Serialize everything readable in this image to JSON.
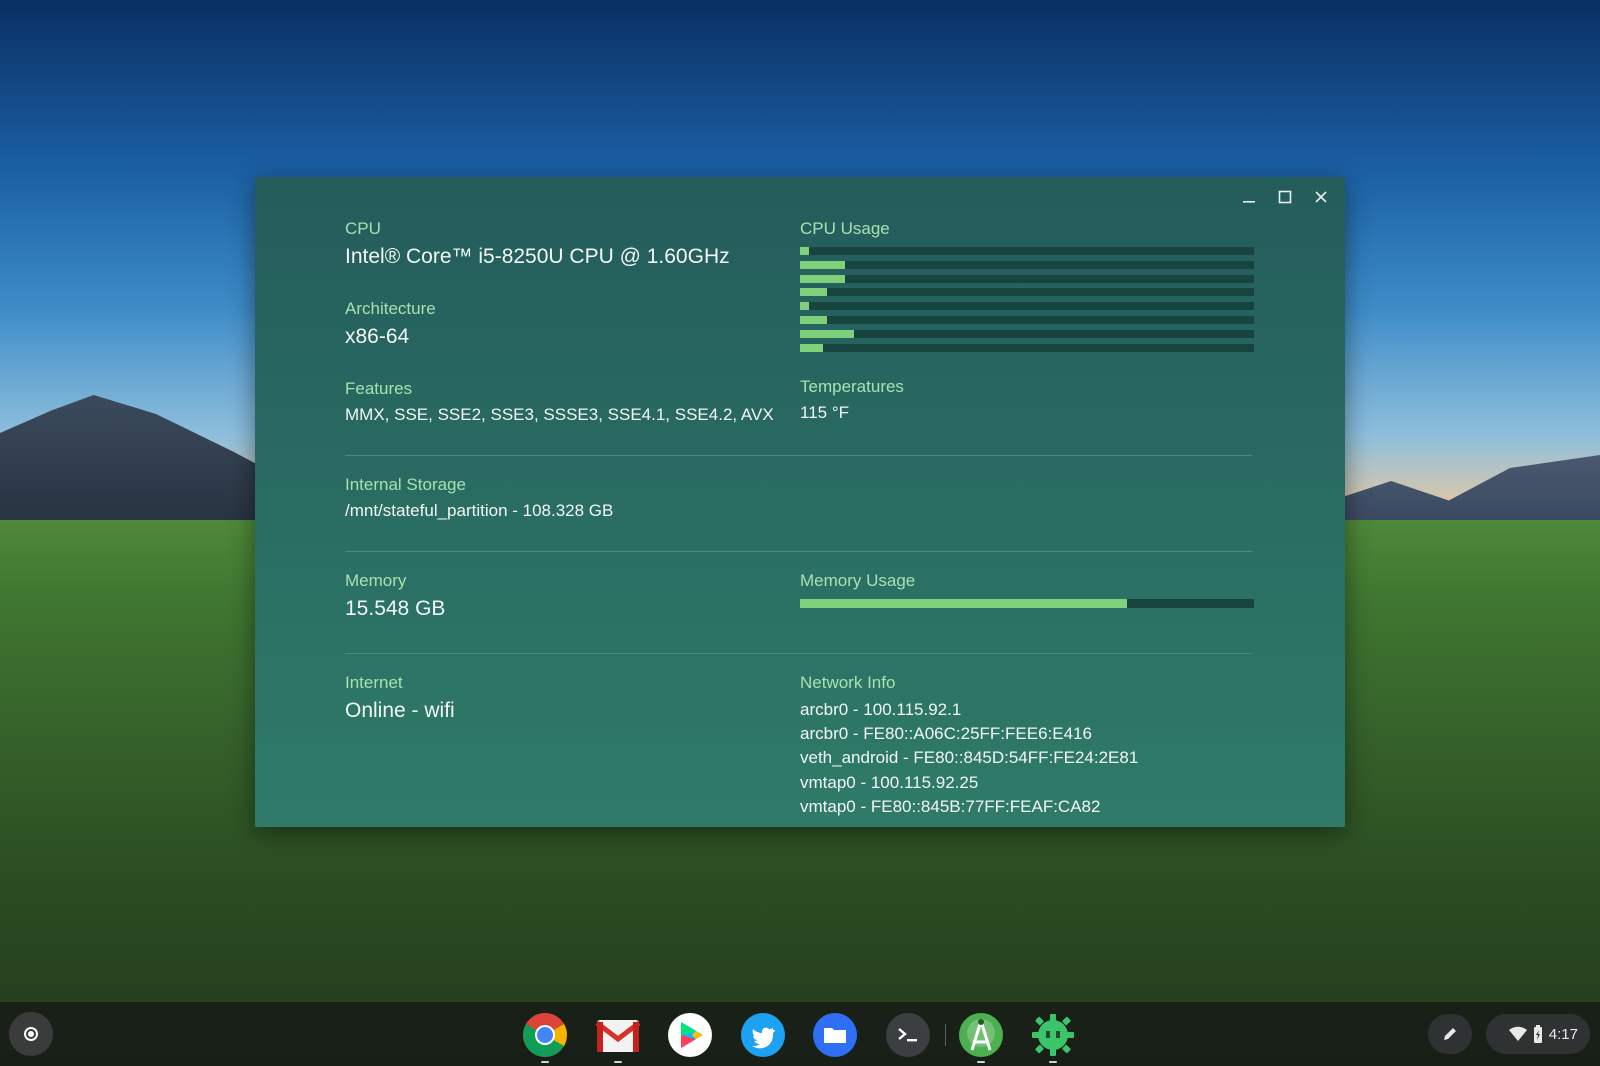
{
  "window": {
    "controls": [
      "minimize",
      "maximize",
      "close"
    ]
  },
  "cpu": {
    "label": "CPU",
    "value": "Intel® Core™ i5-8250U CPU @ 1.60GHz"
  },
  "architecture": {
    "label": "Architecture",
    "value": "x86-64"
  },
  "features": {
    "label": "Features",
    "value": "MMX, SSE, SSE2, SSE3, SSSE3, SSE4.1, SSE4.2, AVX"
  },
  "cpu_usage": {
    "label": "CPU Usage",
    "cores_percent": [
      2,
      10,
      10,
      6,
      2,
      6,
      12,
      5
    ]
  },
  "temperatures": {
    "label": "Temperatures",
    "value": "115 °F"
  },
  "storage": {
    "label": "Internal Storage",
    "value": "/mnt/stateful_partition - 108.328 GB"
  },
  "memory": {
    "label": "Memory",
    "value": "15.548 GB"
  },
  "memory_usage": {
    "label": "Memory Usage",
    "percent": 72
  },
  "internet": {
    "label": "Internet",
    "value": "Online - wifi"
  },
  "network": {
    "label": "Network Info",
    "lines": [
      "arcbr0 - 100.115.92.1",
      "arcbr0 - FE80::A06C:25FF:FEE6:E416",
      "veth_android - FE80::845D:54FF:FE24:2E81",
      "vmtap0 - 100.115.92.25",
      "vmtap0 - FE80::845B:77FF:FEAF:CA82"
    ]
  },
  "shelf": {
    "apps": [
      "chrome-icon",
      "gmail-icon",
      "play-store-icon",
      "twitter-icon",
      "files-icon",
      "terminal-icon",
      "android-studio-icon",
      "cog-app-icon"
    ],
    "time": "4:17"
  },
  "colors": {
    "accent_green": "#7ed07a",
    "window_bg": "#2a6e63",
    "label_green": "#a9e0b0"
  }
}
